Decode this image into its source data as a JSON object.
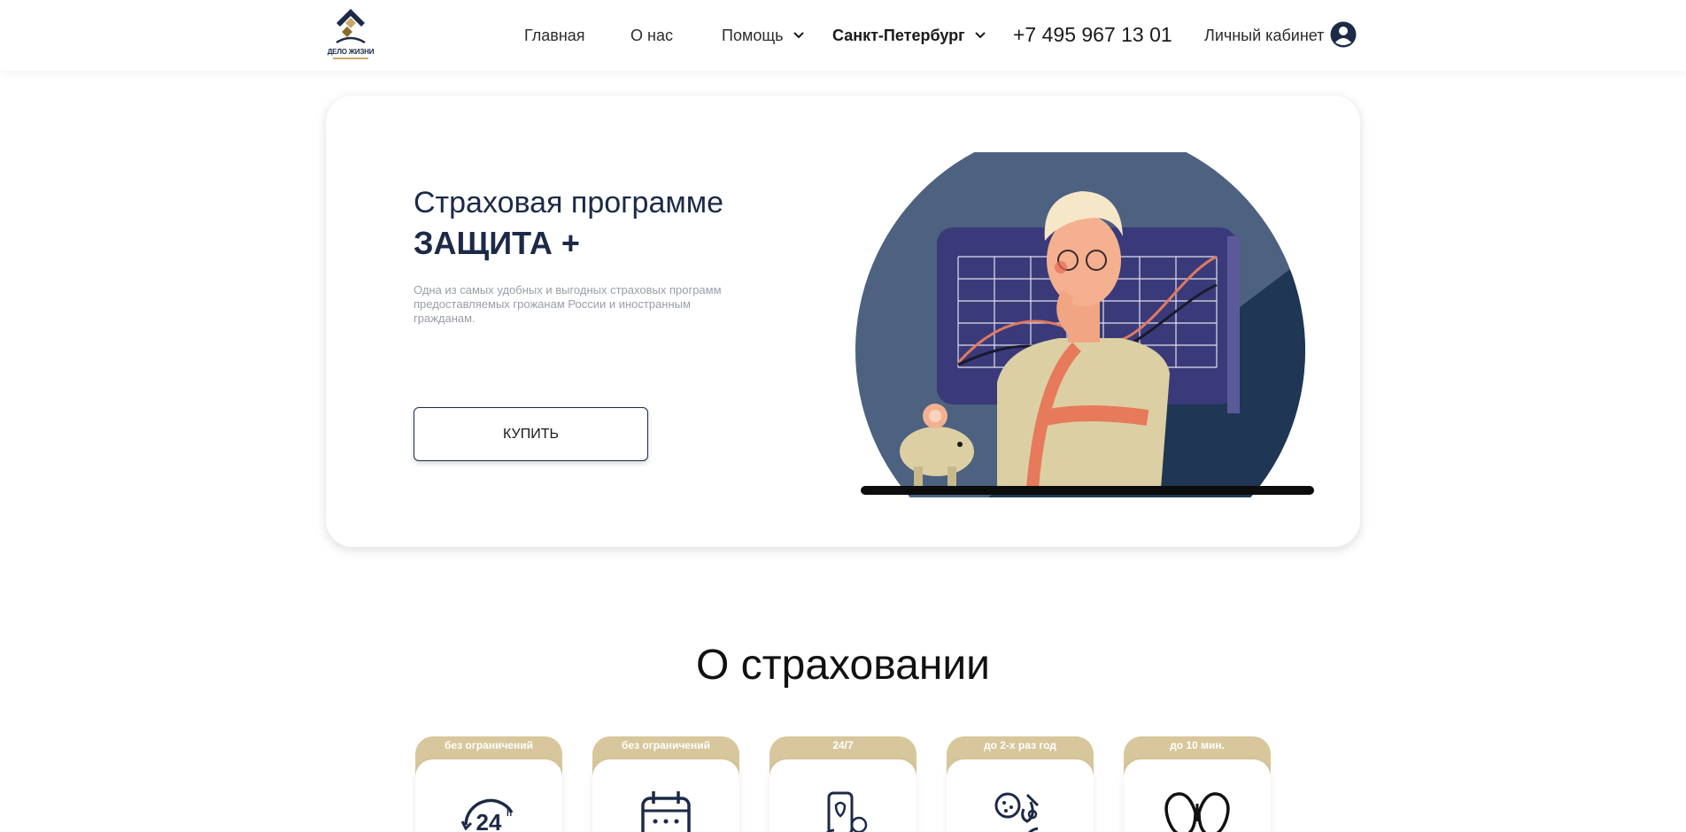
{
  "header": {
    "logo_text": "ДЕЛО ЖИЗНИ",
    "nav": {
      "home": "Главная",
      "about": "О нас",
      "help": "Помощь",
      "city": "Санкт-Петербург"
    },
    "phone": "+7 495 967 13 01",
    "cabinet": "Личный кабинет",
    "icons": [
      "logo-icon",
      "chevron-down-icon",
      "user-icon"
    ]
  },
  "hero": {
    "title_line1": "Страховая программе",
    "title_line2": "ЗАЩИТА +",
    "description": "Одна из самых удобных и выгодных страховых программ предоставляемых грожанам России и иностранным гражданам.",
    "buy_label": "КУПИТЬ"
  },
  "about": {
    "title": "О страховании",
    "cards": [
      {
        "tag": "без ограничений",
        "icon": "24h-icon"
      },
      {
        "tag": "без ограничений",
        "icon": "calendar-icon"
      },
      {
        "tag": "24/7",
        "icon": "phone-support-icon"
      },
      {
        "tag": "до 2-х раз год",
        "icon": "virus-icon"
      },
      {
        "tag": "до 10 мин.",
        "icon": "lungs-icon"
      }
    ]
  },
  "colors": {
    "navy": "#1c2a47",
    "gold": "#d8c79c",
    "circle_light": "#4d6180",
    "circle_dark": "#1f3655",
    "board": "#3a3a7a"
  }
}
